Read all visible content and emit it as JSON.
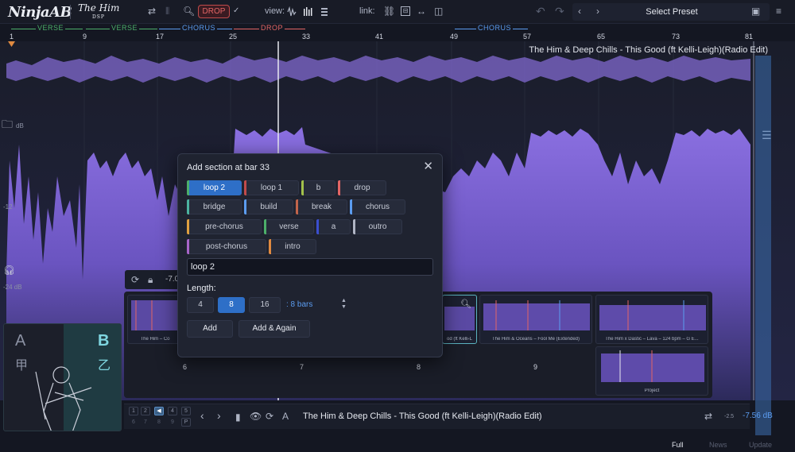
{
  "topbar": {
    "logo": "NinjaAB",
    "partner_logo": "The Him",
    "partner_sub": "DSP",
    "drop_label": "DROP",
    "view_label": "view:",
    "link_label": "link:",
    "preset_label": "Select Preset",
    "icons": [
      "swap-icon",
      "bolt-icon",
      "search-icon",
      "check-icon",
      "waveform-icon",
      "spectrum-icon",
      "stack-icon",
      "unlink-icon",
      "fit-icon",
      "stretch-icon",
      "columns-icon",
      "undo-icon",
      "redo-icon",
      "chevron-left-icon",
      "chevron-right-icon",
      "save-icon",
      "menu-icon"
    ]
  },
  "sections": [
    {
      "label": "VERSE",
      "color": "#4caf6a"
    },
    {
      "label": "VERSE",
      "color": "#4caf6a"
    },
    {
      "label": "CHORUS",
      "color": "#5b9cf0"
    },
    {
      "label": "DROP",
      "color": "#e36565"
    },
    {
      "label": "CHORUS",
      "color": "#5b9cf0"
    }
  ],
  "bar_numbers": [
    "1",
    "9",
    "17",
    "25",
    "33",
    "41",
    "49",
    "57",
    "65",
    "73",
    "81"
  ],
  "waveform": {
    "track_title": "The Him & Deep Chills - This Good (ft Kelli-Leigh)(Radio Edit)",
    "db_labels": [
      "dB",
      "-12",
      "-24 dB"
    ]
  },
  "modal": {
    "title": "Add section at bar 33",
    "chips": [
      {
        "label": "loop 2",
        "color": "#4caf6a",
        "selected": true
      },
      {
        "label": "loop 1",
        "color": "#c14b4b"
      },
      {
        "label": "b",
        "color": "#a3c14b"
      },
      {
        "label": "drop",
        "color": "#e36565"
      },
      {
        "label": "bridge",
        "color": "#4cb3a0"
      },
      {
        "label": "build",
        "color": "#5b9cf0"
      },
      {
        "label": "break",
        "color": "#c1644b"
      },
      {
        "label": "chorus",
        "color": "#5b9cf0"
      },
      {
        "label": "pre-chorus",
        "color": "#e0a040"
      },
      {
        "label": "verse",
        "color": "#4caf6a"
      },
      {
        "label": "a",
        "color": "#3b4fd0"
      },
      {
        "label": "outro",
        "color": "#b0b5c4"
      },
      {
        "label": "post-chorus",
        "color": "#a865c9"
      },
      {
        "label": "intro",
        "color": "#e08a40"
      }
    ],
    "name_value": "loop 2",
    "length_label": "Length:",
    "length_options": [
      "4",
      "8",
      "16"
    ],
    "length_selected": "8",
    "length_bars": ": 8 bars",
    "add_label": "Add",
    "add_again_label": "Add & Again"
  },
  "thumbnails": [
    {
      "caption": "The Him – Co",
      "bar": "6"
    },
    {
      "caption": "od (ft Kelli-L",
      "bar": ""
    },
    {
      "caption": "The Him & Oceans – Fool Me (Extended)",
      "bar": ""
    },
    {
      "caption": "The Him x Dastic – Lava – 124 bpm – G E...",
      "bar": ""
    },
    {
      "caption": "Project",
      "bar": ""
    }
  ],
  "grid_labels": [
    "6",
    "7",
    "8",
    "9"
  ],
  "transport": {
    "gain": "-7.0",
    "slots_row1": [
      "1",
      "2",
      "3",
      "4",
      "5"
    ],
    "slots_row2": [
      "6",
      "7",
      "8",
      "9",
      "P"
    ],
    "track_title": "The Him & Deep Chills - This Good (ft Kelli-Leigh)(Radio Edit)",
    "lufs_small": "-2.5",
    "lufs_value": "-7.56 dB"
  },
  "ninja": {
    "a_label": "A",
    "a_sub": "甲",
    "b_label": "B",
    "b_sub": "乙"
  },
  "footer": {
    "tabs": [
      "Full",
      "News",
      "Update"
    ]
  }
}
